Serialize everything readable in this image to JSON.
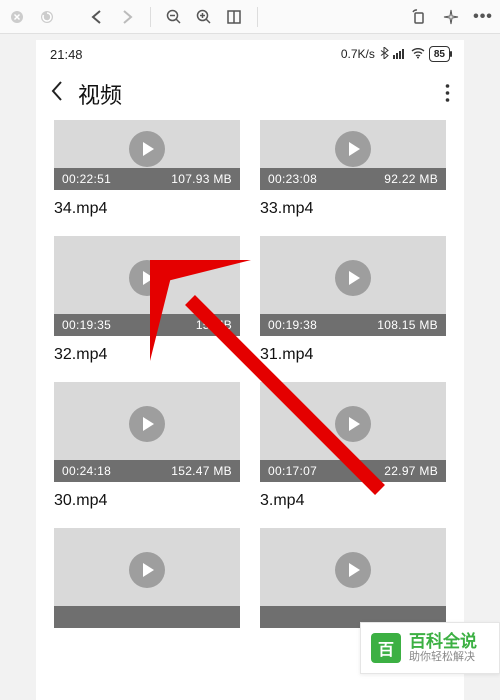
{
  "status": {
    "time": "21:48",
    "net_speed": "0.7K/s",
    "battery_pct": "85"
  },
  "header": {
    "title": "视频"
  },
  "videos": [
    {
      "duration": "00:22:51",
      "size": "107.93 MB",
      "name": "34.mp4"
    },
    {
      "duration": "00:23:08",
      "size": "92.22 MB",
      "name": "33.mp4"
    },
    {
      "duration": "00:19:35",
      "size": "15 MB",
      "name": "32.mp4"
    },
    {
      "duration": "00:19:38",
      "size": "108.15 MB",
      "name": "31.mp4"
    },
    {
      "duration": "00:24:18",
      "size": "152.47 MB",
      "name": "30.mp4"
    },
    {
      "duration": "00:17:07",
      "size": "22.97 MB",
      "name": "3.mp4"
    },
    {
      "duration": "",
      "size": "",
      "name": ""
    },
    {
      "duration": "",
      "size": "",
      "name": ""
    }
  ],
  "badge": {
    "logo_char": "百",
    "line1": "百科全说",
    "line2": "助你轻松解决"
  }
}
